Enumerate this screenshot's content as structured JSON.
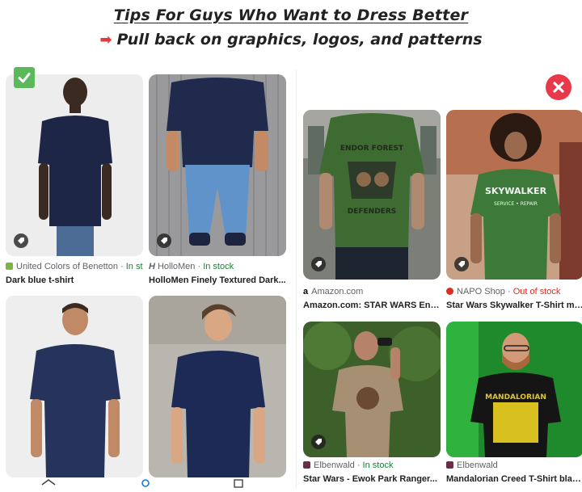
{
  "headline": {
    "line1": "Tips For Guys Who Want to Dress Better",
    "line2": "Pull back on graphics, logos, and patterns"
  },
  "badges": {
    "good": "check-icon",
    "bad": "close-icon"
  },
  "left_cards": [
    {
      "source": "United Colors of Benetton",
      "stock": "In st",
      "title": "Dark blue t-shirt"
    },
    {
      "source": "HolloMen",
      "stock": "In stock",
      "title": "HolloMen Finely Textured Dark..."
    },
    {
      "source": "",
      "stock": "",
      "title": ""
    },
    {
      "source": "",
      "stock": "",
      "title": ""
    }
  ],
  "right_cards": [
    {
      "source": "Amazon.com",
      "stock": "",
      "title": "Amazon.com: STAR WARS Endo..."
    },
    {
      "source": "NAPO Shop",
      "stock": "Out of stock",
      "title": "Star Wars Skywalker T-Shirt mal..."
    },
    {
      "source": "Elbenwald",
      "stock": "In stock",
      "title": "Star Wars - Ewok Park Ranger..."
    },
    {
      "source": "Elbenwald",
      "stock": "",
      "title": "Mandalorian Creed T-Shirt blac..."
    }
  ],
  "shirt_prints": {
    "endor_top": "ENDOR FOREST",
    "endor_bottom": "DEFENDERS",
    "skywalker": "SKYWALKER",
    "skywalker_sub": "SERVICE • REPAIR",
    "mandalorian": "MANDALORIAN"
  },
  "colors": {
    "in_stock": "#188038",
    "out_of_stock": "#d93025",
    "ok": "#5bb85b",
    "bad": "#e8384a"
  }
}
